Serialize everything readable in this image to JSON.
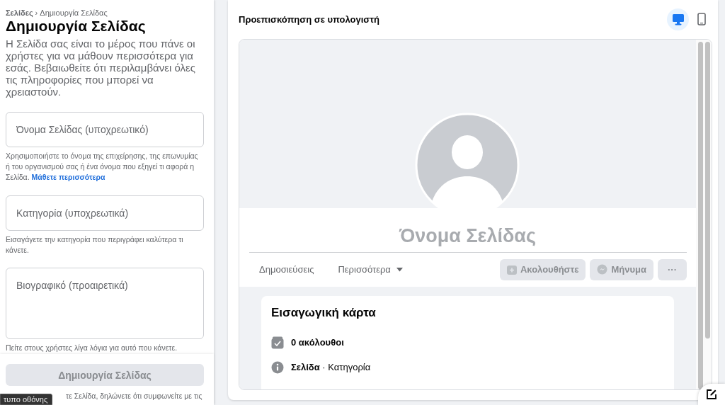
{
  "breadcrumb": [
    {
      "label": "Σελίδες",
      "current": false
    },
    {
      "label": "Δημιουργία Σελίδας",
      "current": true
    }
  ],
  "breadcrumb_separator": "›",
  "title": "Δημιουργία Σελίδας",
  "description": "Η Σελίδα σας είναι το μέρος που πάνε οι χρήστες για να μάθουν περισσότερα για εσάς. Βεβαιωθείτε ότι περιλαμβάνει όλες τις πληροφορίες που μπορεί να χρειαστούν.",
  "fields": [
    {
      "kind": "input",
      "placeholder": "Όνομα Σελίδας (υποχρεωτικό)",
      "help": "Χρησιμοποιήστε το όνομα της επιχείρησης, της επωνυμίας ή του οργανισμού σας ή ένα όνομα που εξηγεί τι αφορά η Σελίδα.",
      "help_link": "Μάθετε περισσότερα"
    },
    {
      "kind": "input",
      "placeholder": "Κατηγορία (υποχρεωτικά)",
      "help": "Εισαγάγετε την κατηγορία που περιγράφει καλύτερα τι κάνετε."
    },
    {
      "kind": "textarea",
      "placeholder": "Βιογραφικό (προαιρετικά)",
      "help": "Πείτε στους χρήστες λίγα λόγια για αυτό που κάνετε."
    }
  ],
  "create_button": {
    "label": "Δημιουργία Σελίδας",
    "disabled": true
  },
  "terms_text": "τε Σελίδα, δηλώνετε ότι συμφωνείτε με τις",
  "tooltip": "τυπο οθόνης",
  "preview": {
    "title": "Προεπισκόπηση σε υπολογιστή",
    "devices": [
      {
        "kind": "desktop",
        "selected": true
      },
      {
        "kind": "mobile",
        "selected": false
      }
    ],
    "page_name": "Όνομα Σελίδας",
    "tabs": [
      {
        "label": "Δημοσιεύσεις",
        "dropdown": false
      },
      {
        "label": "Περισσότερα",
        "dropdown": true
      }
    ],
    "actions": [
      {
        "kind": "follow",
        "label": "Ακολουθήστε",
        "disabled": true
      },
      {
        "kind": "message",
        "label": "Μήνυμα",
        "disabled": true
      },
      {
        "kind": "more",
        "label": "···",
        "disabled": true
      }
    ],
    "intro": {
      "title": "Εισαγωγική κάρτα",
      "items": [
        {
          "kind": "followers",
          "text": "**0 ακόλουθοι**"
        },
        {
          "kind": "info",
          "text": "**Σελίδα** · Κατηγορία"
        }
      ]
    }
  }
}
